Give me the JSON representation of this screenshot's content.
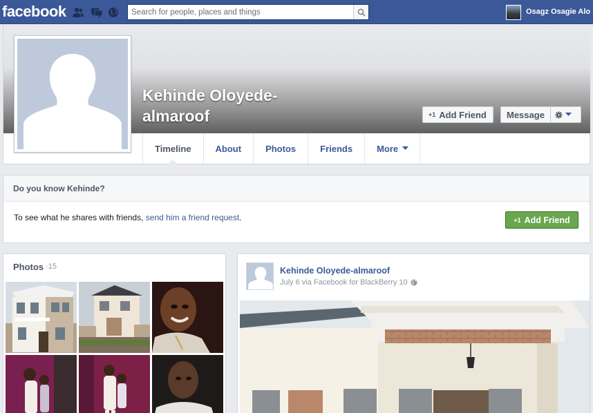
{
  "topbar": {
    "logo": "facebook",
    "search_placeholder": "Search for people, places and things",
    "user_name": "Osagz Osagie Alo"
  },
  "profile": {
    "name": "Kehinde Oloyede-almaroof",
    "add_friend_label": "Add Friend",
    "message_label": "Message",
    "plus_symbol": "+1"
  },
  "tabs": [
    {
      "label": "Timeline"
    },
    {
      "label": "About"
    },
    {
      "label": "Photos"
    },
    {
      "label": "Friends"
    },
    {
      "label": "More"
    }
  ],
  "know": {
    "title": "Do you know Kehinde?",
    "text_before": "To see what he shares with friends, ",
    "link": "send him a friend request",
    "text_after": ".",
    "button_label": "Add Friend"
  },
  "photos": {
    "title": "Photos",
    "separator": " · ",
    "count": "15"
  },
  "post": {
    "author": "Kehinde Oloyede-almaroof",
    "meta": "July 6 via Facebook for BlackBerry 10"
  },
  "colors": {
    "brand_blue": "#3b5998",
    "green_button": "#69a74e"
  }
}
